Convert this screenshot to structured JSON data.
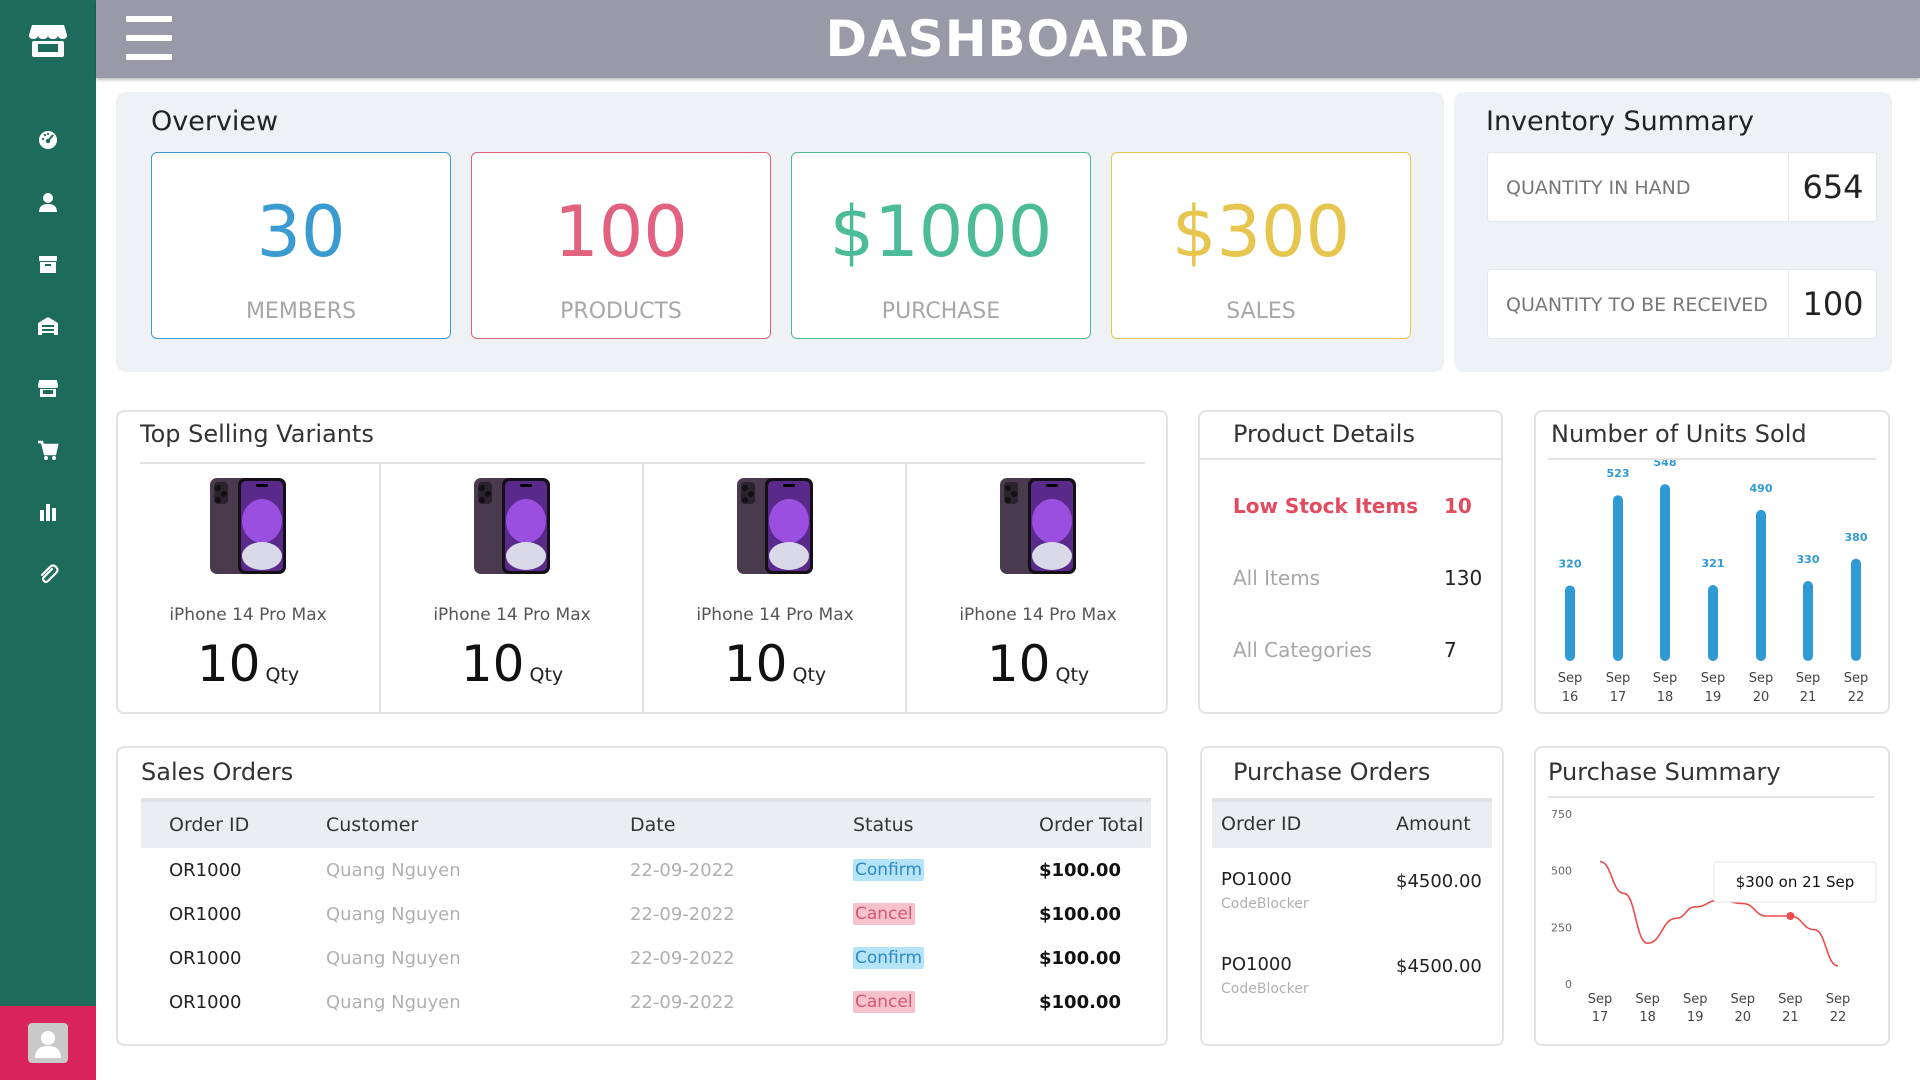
{
  "header": {
    "title": "DASHBOARD"
  },
  "sidebar": {
    "items": [
      {
        "icon": "gauge-icon"
      },
      {
        "icon": "user-icon"
      },
      {
        "icon": "archive-icon"
      },
      {
        "icon": "warehouse-icon"
      },
      {
        "icon": "store-icon"
      },
      {
        "icon": "cart-icon"
      },
      {
        "icon": "chart-icon"
      },
      {
        "icon": "paperclip-icon"
      }
    ]
  },
  "overview": {
    "title": "Overview",
    "cards": [
      {
        "value": "30",
        "label": "MEMBERS",
        "color": "#3a9bd1"
      },
      {
        "value": "100",
        "label": "PRODUCTS",
        "color": "#e2617f"
      },
      {
        "value": "$1000",
        "label": "PURCHASE",
        "color": "#4cbc98"
      },
      {
        "value": "$300",
        "label": "SALES",
        "color": "#e6c64f"
      }
    ]
  },
  "inventory": {
    "title": "Inventory Summary",
    "rows": [
      {
        "label": "QUANTITY IN HAND",
        "value": "654"
      },
      {
        "label": "QUANTITY TO BE RECEIVED",
        "value": "100"
      }
    ]
  },
  "top_selling": {
    "title": "Top Selling Variants",
    "items": [
      {
        "name": "iPhone 14 Pro Max",
        "qty": "10",
        "unit": "Qty"
      },
      {
        "name": "iPhone 14 Pro Max",
        "qty": "10",
        "unit": "Qty"
      },
      {
        "name": "iPhone 14 Pro Max",
        "qty": "10",
        "unit": "Qty"
      },
      {
        "name": "iPhone 14 Pro Max",
        "qty": "10",
        "unit": "Qty"
      }
    ]
  },
  "product_details": {
    "title": "Product Details",
    "rows": [
      {
        "label": "Low Stock Items",
        "value": "10",
        "color": "#e24a5f"
      },
      {
        "label": "All Items",
        "value": "130",
        "color": "#a7a7a7"
      },
      {
        "label": "All Categories",
        "value": "7",
        "color": "#a7a7a7"
      }
    ]
  },
  "units_sold": {
    "title": "Number of Units Sold",
    "bar_color": "#2f9ad6",
    "dates": [
      [
        "Sep",
        "16"
      ],
      [
        "Sep",
        "17"
      ],
      [
        "Sep",
        "18"
      ],
      [
        "Sep",
        "19"
      ],
      [
        "Sep",
        "20"
      ],
      [
        "Sep",
        "21"
      ],
      [
        "Sep",
        "22"
      ]
    ]
  },
  "sales_orders": {
    "title": "Sales Orders",
    "columns": [
      "Order ID",
      "Customer",
      "Date",
      "Status",
      "Order Total"
    ],
    "rows": [
      {
        "id": "OR1000",
        "customer": "Quang Nguyen",
        "date": "22-09-2022",
        "status": "Confirm",
        "total": "$100.00"
      },
      {
        "id": "OR1000",
        "customer": "Quang Nguyen",
        "date": "22-09-2022",
        "status": "Cancel",
        "total": "$100.00"
      },
      {
        "id": "OR1000",
        "customer": "Quang Nguyen",
        "date": "22-09-2022",
        "status": "Confirm",
        "total": "$100.00"
      },
      {
        "id": "OR1000",
        "customer": "Quang Nguyen",
        "date": "22-09-2022",
        "status": "Cancel",
        "total": "$100.00"
      }
    ]
  },
  "purchase_orders": {
    "title": "Purchase Orders",
    "columns": [
      "Order ID",
      "Amount"
    ],
    "rows": [
      {
        "id": "PO1000",
        "vendor": "CodeBlocker",
        "amount": "$4500.00"
      },
      {
        "id": "PO1000",
        "vendor": "CodeBlocker",
        "amount": "$4500.00"
      }
    ]
  },
  "purchase_summary": {
    "title": "Purchase Summary",
    "tooltip": "$300 on 21 Sep",
    "line_color": "#ea4d4d"
  },
  "chart_data": [
    {
      "type": "bar",
      "title": "Number of Units Sold",
      "categories": [
        "Sep 16",
        "Sep 17",
        "Sep 18",
        "Sep 19",
        "Sep 20",
        "Sep 21",
        "Sep 22"
      ],
      "values": [
        320,
        523,
        548,
        321,
        490,
        330,
        380
      ],
      "ylim": [
        0,
        600
      ],
      "grid": false
    },
    {
      "type": "line",
      "title": "Purchase Summary",
      "categories": [
        "Sep 17",
        "Sep 18",
        "Sep 19",
        "Sep 20",
        "Sep 21",
        "Sep 22"
      ],
      "x": [
        17,
        17.5,
        18,
        18.6,
        19,
        19.5,
        20,
        20.5,
        21,
        21.5,
        22
      ],
      "values": [
        540,
        400,
        180,
        290,
        340,
        370,
        355,
        300,
        300,
        240,
        80
      ],
      "yticks": [
        0,
        250,
        500,
        750
      ],
      "ylim": [
        0,
        750
      ],
      "grid": false
    }
  ]
}
